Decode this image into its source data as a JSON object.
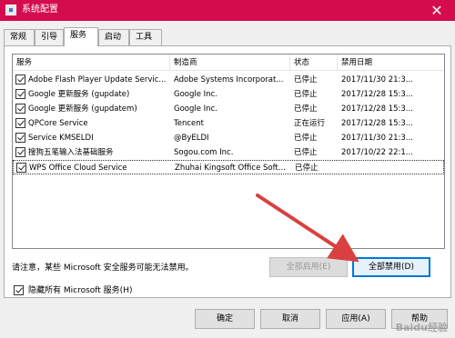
{
  "window": {
    "title": "系统配置",
    "close_glyph": "✕"
  },
  "tabs": [
    {
      "label": "常规",
      "active": false
    },
    {
      "label": "引导",
      "active": false
    },
    {
      "label": "服务",
      "active": true
    },
    {
      "label": "启动",
      "active": false
    },
    {
      "label": "工具",
      "active": false
    }
  ],
  "services": {
    "columns": [
      "服务",
      "制造商",
      "状态",
      "禁用日期"
    ],
    "rows": [
      {
        "name": "Adobe Flash Player Update Servic...",
        "vendor": "Adobe Systems Incorporat...",
        "status": "已停止",
        "date": "2017/11/30 21:3...",
        "checked": true
      },
      {
        "name": "Google 更新服务 (gupdate)",
        "vendor": "Google Inc.",
        "status": "已停止",
        "date": "2017/12/28 15:3...",
        "checked": true
      },
      {
        "name": "Google 更新服务 (gupdatem)",
        "vendor": "Google Inc.",
        "status": "已停止",
        "date": "2017/12/28 15:3...",
        "checked": true
      },
      {
        "name": "QPCore Service",
        "vendor": "Tencent",
        "status": "正在运行",
        "date": "2017/12/28 15:3...",
        "checked": true
      },
      {
        "name": "Service KMSELDI",
        "vendor": "@ByELDI",
        "status": "已停止",
        "date": "2017/11/30 21:3...",
        "checked": true
      },
      {
        "name": "搜狗五笔输入法基础服务",
        "vendor": "Sogou.com Inc.",
        "status": "已停止",
        "date": "2017/10/22 22:1...",
        "checked": true
      },
      {
        "name": "WPS Office Cloud Service",
        "vendor": "Zhuhai Kingsoft Office Soft...",
        "status": "已停止",
        "date": "",
        "checked": true
      }
    ]
  },
  "notice": "请注意，某些 Microsoft 安全服务可能无法禁用。",
  "buttons": {
    "enable_all": "全部启用(E)",
    "disable_all": "全部禁用(D)",
    "ok": "确定",
    "cancel": "取消",
    "apply": "应用(A)",
    "help": "帮助"
  },
  "hide_ms": {
    "label": "隐藏所有 Microsoft 服务(H)",
    "checked": true
  },
  "watermark": "Baidu经验",
  "colors": {
    "titlebar": "#d40c4e",
    "arrow": "#d8413f",
    "focus": "#0078d7"
  }
}
